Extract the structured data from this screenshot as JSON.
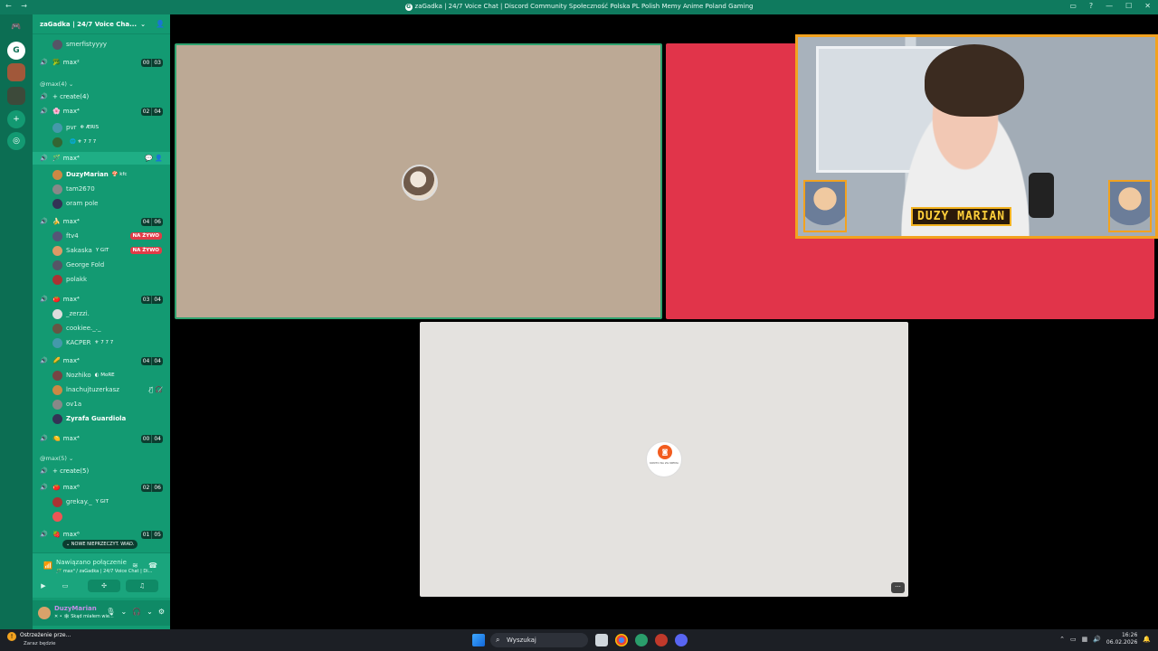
{
  "titlebar": {
    "nav": "← →",
    "title": "zaGadka | 24/7 Voice Chat | Discord Community Społeczność Polska PL Polish Memy Anime Poland Gaming",
    "server_icon_letter": "G"
  },
  "server": {
    "name": "zaGadka | 24/7 Voice Cha...",
    "chevron": "⌄"
  },
  "channels": [
    {
      "type": "user",
      "name": "smerfistyyyy"
    },
    {
      "type": "channel",
      "emoji": "🥦",
      "name": "max²",
      "counts": [
        "00",
        "03"
      ]
    },
    {
      "type": "category",
      "name": "@max(4) ⌄"
    },
    {
      "type": "channel",
      "emoji": "",
      "name": "+ create(4)"
    },
    {
      "type": "channel",
      "emoji": "🌸",
      "name": "max⁴",
      "counts": [
        "02",
        "04"
      ]
    },
    {
      "type": "user",
      "name": "pvr",
      "tag": "❄ ÆRIS"
    },
    {
      "type": "user",
      "name": "",
      "tag": "🌐 ⚜ 7 7 7"
    },
    {
      "type": "channel",
      "emoji": "🪄",
      "name": "max⁴",
      "active": true
    },
    {
      "type": "user",
      "name": "DuzyMarian",
      "tag": "🍄 kfc",
      "bold": true
    },
    {
      "type": "user",
      "name": "tam2670"
    },
    {
      "type": "user",
      "name": "oram pole"
    },
    {
      "type": "channel",
      "emoji": "🍌",
      "name": "max⁴",
      "counts": [
        "04",
        "06"
      ]
    },
    {
      "type": "user",
      "name": "ftv4",
      "live": "NA ŻYWO"
    },
    {
      "type": "user",
      "name": "Sakaska",
      "tag": "Y GIT",
      "live": "NA ŻYWO"
    },
    {
      "type": "user",
      "name": "George Fold"
    },
    {
      "type": "user",
      "name": "polakk"
    },
    {
      "type": "channel",
      "emoji": "🍅",
      "name": "max⁴",
      "counts": [
        "03",
        "04"
      ]
    },
    {
      "type": "user",
      "name": "_zerzzi."
    },
    {
      "type": "user",
      "name": "cookiee._._"
    },
    {
      "type": "user",
      "name": "KACPER",
      "tag": "⚜ 7 7 7"
    },
    {
      "type": "channel",
      "emoji": "🌽",
      "name": "max⁴",
      "counts": [
        "04",
        "04"
      ]
    },
    {
      "type": "user",
      "name": "Nozhiko",
      "tag": "◐ MoRE"
    },
    {
      "type": "user",
      "name": "lnachujtuzerkasz",
      "icons": "🎙̸ 🎧̸"
    },
    {
      "type": "user",
      "name": "ov1a"
    },
    {
      "type": "user",
      "name": "Zyrafa Guardiola",
      "bold": true
    },
    {
      "type": "channel",
      "emoji": "🍋",
      "name": "max⁴",
      "counts": [
        "00",
        "04"
      ]
    },
    {
      "type": "category",
      "name": "@max(5) ⌄"
    },
    {
      "type": "channel",
      "emoji": "",
      "name": "+ create(5)"
    },
    {
      "type": "channel",
      "emoji": "🍅",
      "name": "max⁶",
      "counts": [
        "02",
        "06"
      ]
    },
    {
      "type": "user",
      "name": "grekay._",
      "tag": "Y GIT"
    },
    {
      "type": "user",
      "name": ""
    },
    {
      "type": "channel",
      "emoji": "🍓",
      "name": "max⁶",
      "counts": [
        "01",
        "05"
      ]
    }
  ],
  "new_unread": "⌄ NOWE NIEPRZECZYT. WIAD.",
  "voice_panel": {
    "status": "Nawiązano połączenie",
    "subtitle": "🪄 max⁴ / zaGadka | 24/7 Voice Chat | Di..."
  },
  "user_panel": {
    "name": "DuzyMarian",
    "status": "✕ • 🕸 Skąd miałem wie..."
  },
  "stream": {
    "name_plate": "DUZY MARIAN"
  },
  "tile3": {
    "avatar_text": "KONTO NA ZG\nNIEMA"
  },
  "taskbar": {
    "notify_title": "Ostrzeżenie prze...",
    "notify_sub": "Zaraz będzie",
    "search": "Wyszukaj",
    "time": "16:26",
    "date": "06.02.2026"
  },
  "colors": {
    "accent": "#139a72",
    "live": "#e23b47",
    "stream_border": "#f2a21f",
    "tile_red": "#e1344a"
  }
}
